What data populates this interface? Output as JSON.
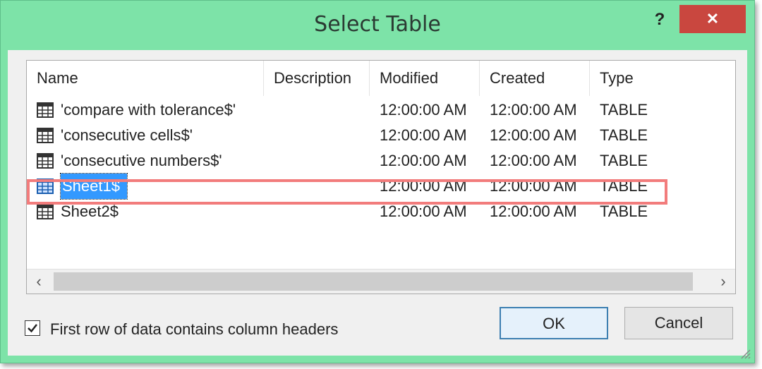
{
  "dialog": {
    "title": "Select Table",
    "help_label": "?",
    "close_label": "✕"
  },
  "table": {
    "columns": [
      "Name",
      "Description",
      "Modified",
      "Created",
      "Type"
    ],
    "rows": [
      {
        "name": "'compare with tolerance$'",
        "description": "",
        "modified": "12:00:00 AM",
        "created": "12:00:00 AM",
        "type": "TABLE",
        "selected": false
      },
      {
        "name": "'consecutive cells$'",
        "description": "",
        "modified": "12:00:00 AM",
        "created": "12:00:00 AM",
        "type": "TABLE",
        "selected": false
      },
      {
        "name": "'consecutive numbers$'",
        "description": "",
        "modified": "12:00:00 AM",
        "created": "12:00:00 AM",
        "type": "TABLE",
        "selected": false
      },
      {
        "name": "Sheet1$",
        "description": "",
        "modified": "12:00:00 AM",
        "created": "12:00:00 AM",
        "type": "TABLE",
        "selected": true
      },
      {
        "name": "Sheet2$",
        "description": "",
        "modified": "12:00:00 AM",
        "created": "12:00:00 AM",
        "type": "TABLE",
        "selected": false
      }
    ],
    "scroll_left_icon": "chevron-left-icon",
    "scroll_right_icon": "chevron-right-icon",
    "scroll_left_glyph": "‹",
    "scroll_right_glyph": "›"
  },
  "options": {
    "header_checkbox_label": "First row of data contains column headers",
    "header_checkbox_checked": true
  },
  "buttons": {
    "ok_label": "OK",
    "cancel_label": "Cancel"
  },
  "colors": {
    "title_bar": "#7de3a8",
    "close_button": "#c9473f",
    "selection": "#3399ff",
    "highlight_box": "#f27c7c"
  }
}
